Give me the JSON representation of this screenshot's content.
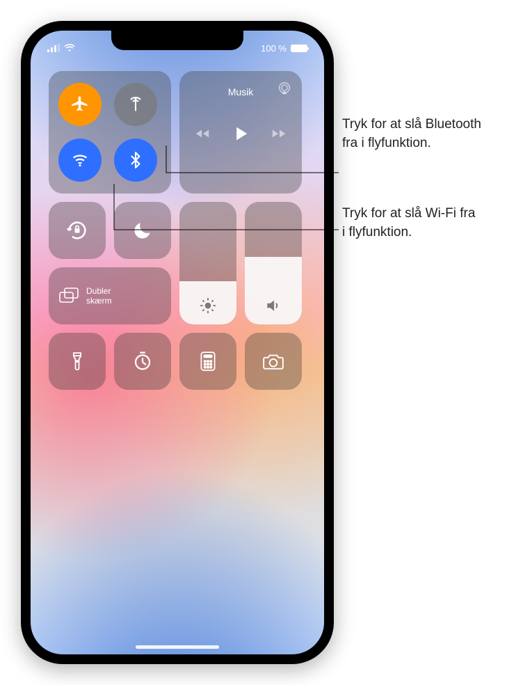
{
  "status": {
    "battery_text": "100 %"
  },
  "music": {
    "label": "Musik"
  },
  "screen_mirroring": {
    "line1": "Dubler",
    "line2": "skærm"
  },
  "sliders": {
    "brightness_pct": 35,
    "volume_pct": 55
  },
  "toggles": {
    "airplane_on": true,
    "cellular_on": false,
    "wifi_on": true,
    "bluetooth_on": true
  },
  "callouts": {
    "bluetooth": "Tryk for at slå Bluetooth fra i flyfunktion.",
    "wifi": "Tryk for at slå Wi-Fi fra i flyfunktion."
  }
}
